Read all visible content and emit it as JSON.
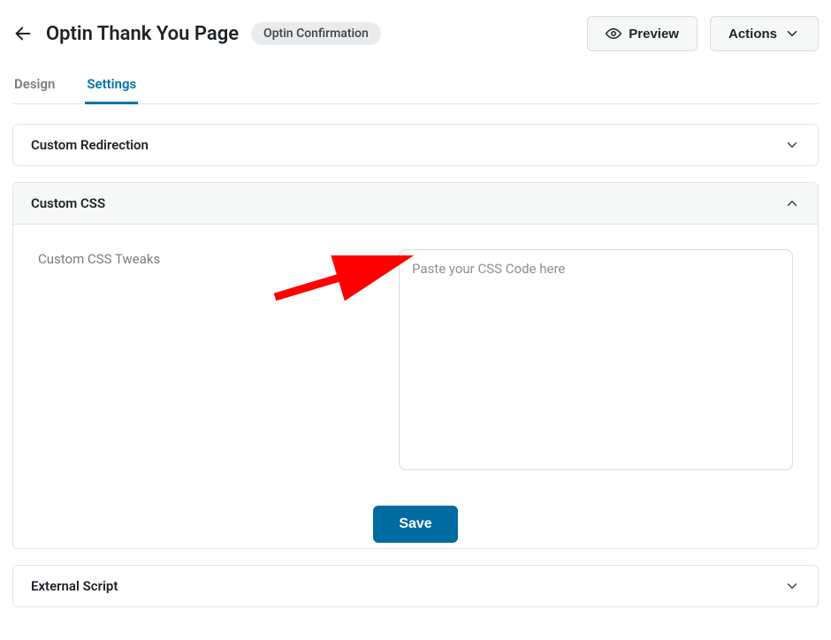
{
  "header": {
    "title": "Optin Thank You Page",
    "badge": "Optin Confirmation",
    "preview_label": "Preview",
    "actions_label": "Actions"
  },
  "tabs": {
    "design_label": "Design",
    "settings_label": "Settings"
  },
  "panels": {
    "custom_redirection": {
      "title": "Custom Redirection"
    },
    "custom_css": {
      "title": "Custom CSS",
      "field_label": "Custom CSS Tweaks",
      "textarea_placeholder": "Paste your CSS Code here",
      "textarea_value": "",
      "save_label": "Save"
    },
    "external_script": {
      "title": "External Script"
    }
  }
}
